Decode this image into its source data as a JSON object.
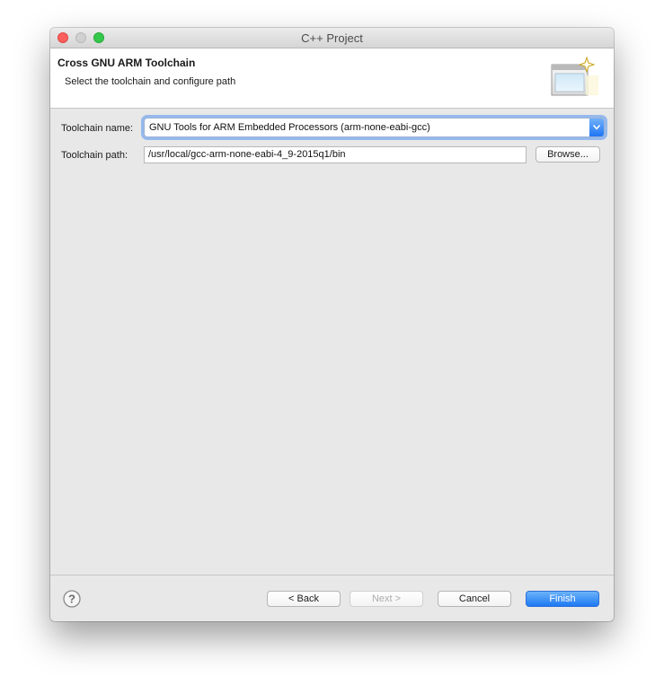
{
  "window": {
    "title": "C++ Project"
  },
  "header": {
    "title": "Cross GNU ARM Toolchain",
    "subtitle": "Select the toolchain and configure path",
    "banner_icon": "new-wizard-icon"
  },
  "form": {
    "toolchain_name_label": "Toolchain name:",
    "toolchain_name_value": "GNU Tools for ARM Embedded Processors (arm-none-eabi-gcc)",
    "toolchain_path_label": "Toolchain path:",
    "toolchain_path_value": "/usr/local/gcc-arm-none-eabi-4_9-2015q1/bin",
    "browse_label": "Browse..."
  },
  "footer": {
    "help_icon": "help-icon",
    "back_label": "< Back",
    "next_label": "Next >",
    "cancel_label": "Cancel",
    "finish_label": "Finish"
  },
  "colors": {
    "accent": "#1e78f2",
    "close": "#fc605c",
    "zoom": "#34c84a"
  }
}
